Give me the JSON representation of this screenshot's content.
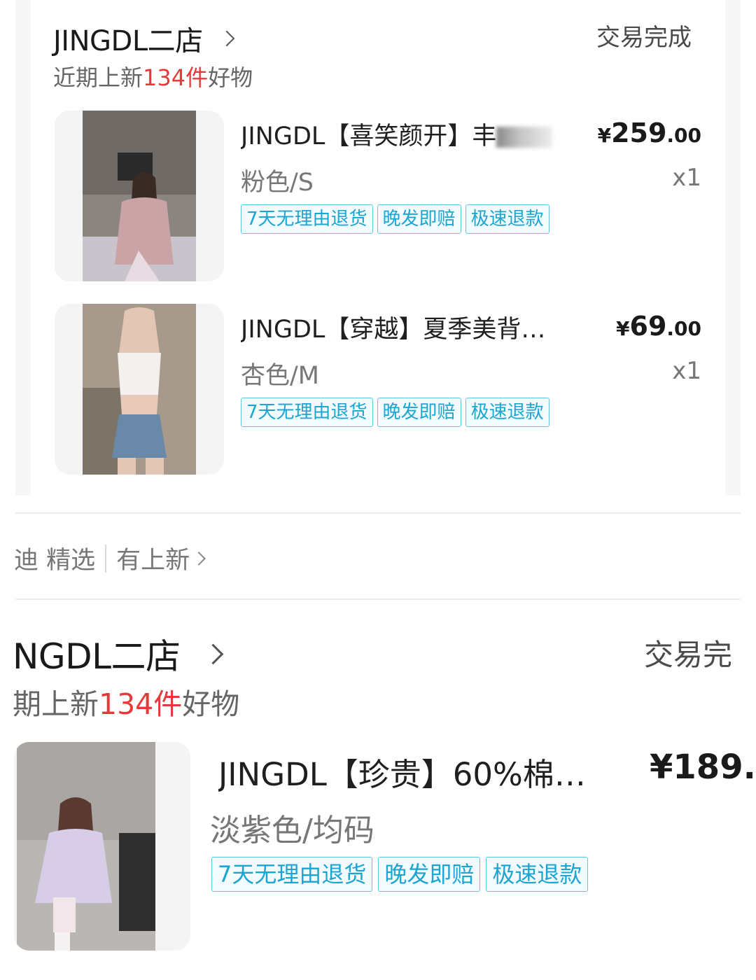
{
  "orders": [
    {
      "store_name": "JINGDL二店",
      "status": "交易完成",
      "subline": {
        "prefix": "近期上新",
        "count": "134件",
        "suffix": "好物"
      },
      "items": [
        {
          "title": "JINGDL【喜笑颜开】",
          "title_tail": "丰",
          "price_symbol": "¥",
          "price_int": "259",
          "price_dec": ".00",
          "variant": "粉色/S",
          "qty": "x1"
        },
        {
          "title": "JINGDL【穿越】夏季美背…",
          "price_symbol": "¥",
          "price_int": "69",
          "price_dec": ".00",
          "variant": "杏色/M",
          "qty": "x1"
        }
      ]
    },
    {
      "store_name": "NGDL二店",
      "status": "交易完",
      "subline": {
        "prefix": "期上新",
        "count": "134件",
        "suffix": "好物"
      },
      "items": [
        {
          "title": "JINGDL【珍贵】60%棉…",
          "price_text": "¥189.(",
          "variant": "淡紫色/均码"
        }
      ]
    }
  ],
  "tags": [
    "7天无理由退货",
    "晚发即赔",
    "极速退款"
  ],
  "mid_bar": {
    "left": "迪 精选",
    "right": "有上新"
  }
}
